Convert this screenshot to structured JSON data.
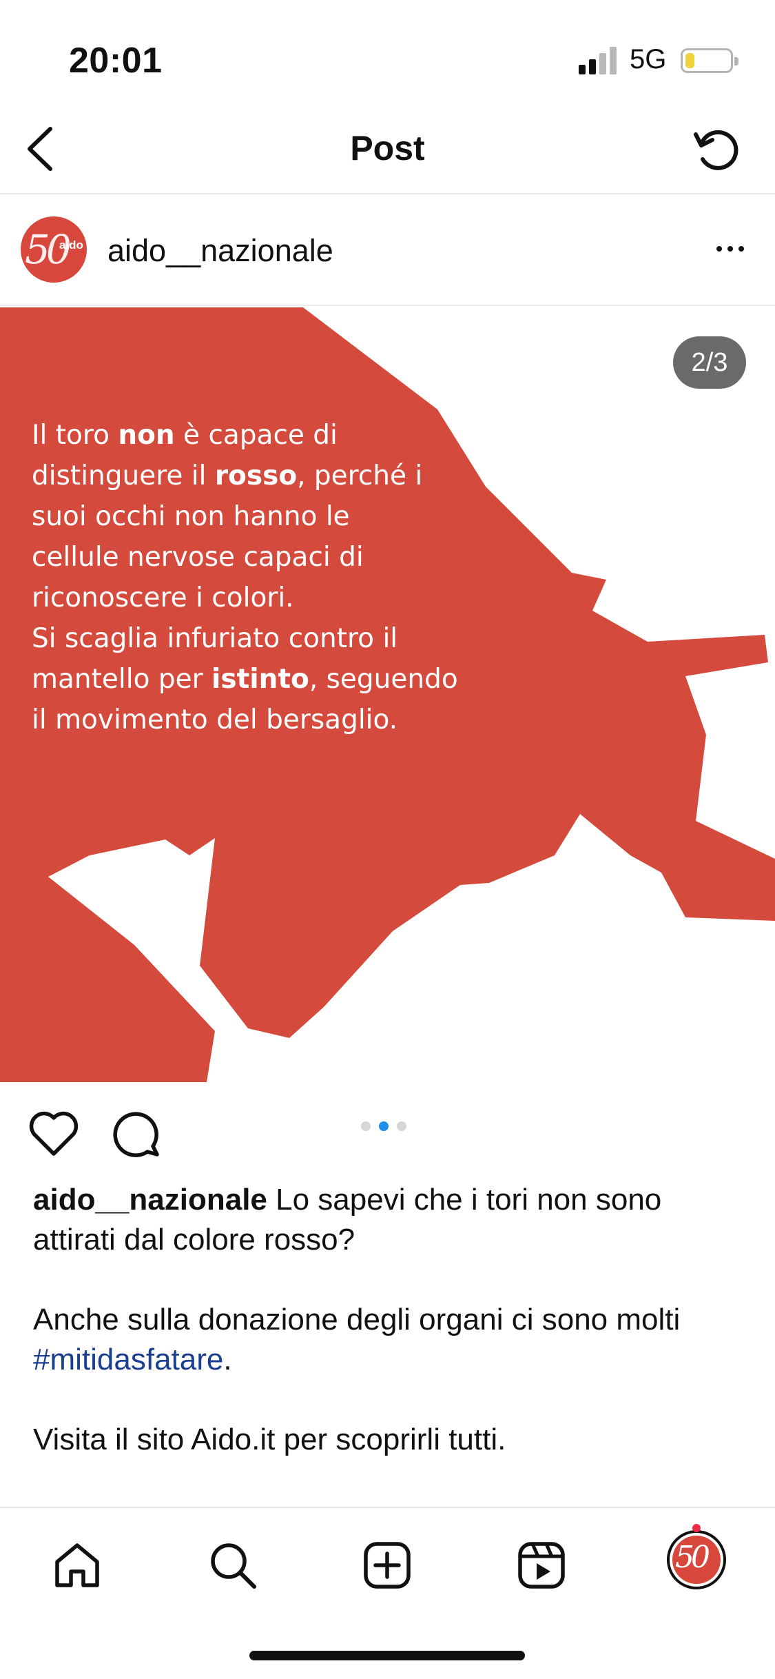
{
  "status_bar": {
    "time": "20:01",
    "network": "5G",
    "battery_level": 0.2,
    "battery_color": "#f2d23c"
  },
  "header": {
    "title": "Post",
    "back_icon": "chevron-left-icon",
    "refresh_icon": "refresh-icon"
  },
  "post": {
    "author": "aido__nazionale",
    "avatar_text": "aido",
    "avatar_digits": "50",
    "more_icon": "more-horizontal-icon",
    "image": {
      "counter": "2/3",
      "accent": "#d44a3c",
      "text_lines": [
        [
          {
            "t": "Il toro "
          },
          {
            "t": "non",
            "b": true
          },
          {
            "t": " è capace di"
          }
        ],
        [
          {
            "t": "distinguere il "
          },
          {
            "t": "rosso",
            "b": true
          },
          {
            "t": ", perché i"
          }
        ],
        [
          {
            "t": "suoi occhi non hanno le"
          }
        ],
        [
          {
            "t": "cellule nervose capaci di"
          }
        ],
        [
          {
            "t": "riconoscere i colori."
          }
        ],
        [
          {
            "t": "Si scaglia infuriato contro il"
          }
        ],
        [
          {
            "t": "mantello per "
          },
          {
            "t": "istinto",
            "b": true
          },
          {
            "t": ", seguendo"
          }
        ],
        [
          {
            "t": "il movimento del bersaglio."
          }
        ]
      ]
    },
    "carousel": {
      "count": 3,
      "active": 1
    },
    "caption": {
      "user": "aido__nazionale",
      "line1": " Lo sapevi che i tori non sono attirati dal colore rosso?",
      "line2_prefix": "Anche sulla donazione degli organi ci sono molti ",
      "hashtag": "#mitidasfatare",
      "line2_suffix": ".",
      "line3": "Visita il sito Aido.it per scoprirli tutti."
    }
  },
  "tabbar": {
    "items": [
      "home-icon",
      "search-icon",
      "create-icon",
      "reels-icon",
      "profile-avatar"
    ],
    "notification_color": "#ee2a45"
  }
}
